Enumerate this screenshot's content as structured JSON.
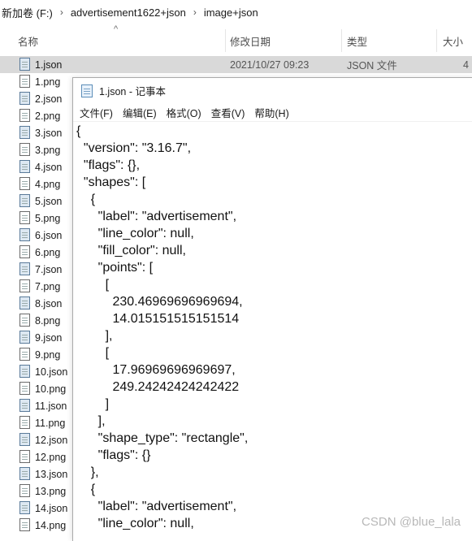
{
  "explorer": {
    "breadcrumb": [
      "新加卷 (F:)",
      "advertisement1622+json",
      "image+json"
    ],
    "separator": "›",
    "columns": {
      "name": "名称",
      "modified": "修改日期",
      "type": "类型",
      "size": "大小"
    },
    "sort_indicator": "^",
    "files": [
      {
        "name": "1.json",
        "date": "2021/10/27 09:23",
        "type": "JSON 文件",
        "size": "4",
        "kind": "json",
        "selected": true
      },
      {
        "name": "1.png",
        "kind": "png"
      },
      {
        "name": "2.json",
        "kind": "json"
      },
      {
        "name": "2.png",
        "kind": "png"
      },
      {
        "name": "3.json",
        "kind": "json"
      },
      {
        "name": "3.png",
        "kind": "png"
      },
      {
        "name": "4.json",
        "kind": "json"
      },
      {
        "name": "4.png",
        "kind": "png"
      },
      {
        "name": "5.json",
        "kind": "json"
      },
      {
        "name": "5.png",
        "kind": "png"
      },
      {
        "name": "6.json",
        "kind": "json"
      },
      {
        "name": "6.png",
        "kind": "png"
      },
      {
        "name": "7.json",
        "kind": "json"
      },
      {
        "name": "7.png",
        "kind": "png"
      },
      {
        "name": "8.json",
        "kind": "json"
      },
      {
        "name": "8.png",
        "kind": "png"
      },
      {
        "name": "9.json",
        "kind": "json"
      },
      {
        "name": "9.png",
        "kind": "png"
      },
      {
        "name": "10.json",
        "kind": "json"
      },
      {
        "name": "10.png",
        "kind": "png"
      },
      {
        "name": "11.json",
        "kind": "json"
      },
      {
        "name": "11.png",
        "kind": "png"
      },
      {
        "name": "12.json",
        "kind": "json"
      },
      {
        "name": "12.png",
        "kind": "png"
      },
      {
        "name": "13.json",
        "kind": "json"
      },
      {
        "name": "13.png",
        "kind": "png"
      },
      {
        "name": "14.json",
        "kind": "json"
      },
      {
        "name": "14.png",
        "kind": "png"
      }
    ]
  },
  "notepad": {
    "title": "1.json - 记事本",
    "menu": [
      "文件(F)",
      "编辑(E)",
      "格式(O)",
      "查看(V)",
      "帮助(H)"
    ],
    "content": "{\n  \"version\": \"3.16.7\",\n  \"flags\": {},\n  \"shapes\": [\n    {\n      \"label\": \"advertisement\",\n      \"line_color\": null,\n      \"fill_color\": null,\n      \"points\": [\n        [\n          230.46969696969694,\n          14.015151515151514\n        ],\n        [\n          17.96969696969697,\n          249.24242424242422\n        ]\n      ],\n      \"shape_type\": \"rectangle\",\n      \"flags\": {}\n    },\n    {\n      \"label\": \"advertisement\",\n      \"line_color\": null,"
  },
  "watermark": "CSDN @blue_lala",
  "colors": {
    "selected_row": "#d9d9d9",
    "header_text": "#4d4d4d",
    "watermark": "#b8b8b8"
  }
}
